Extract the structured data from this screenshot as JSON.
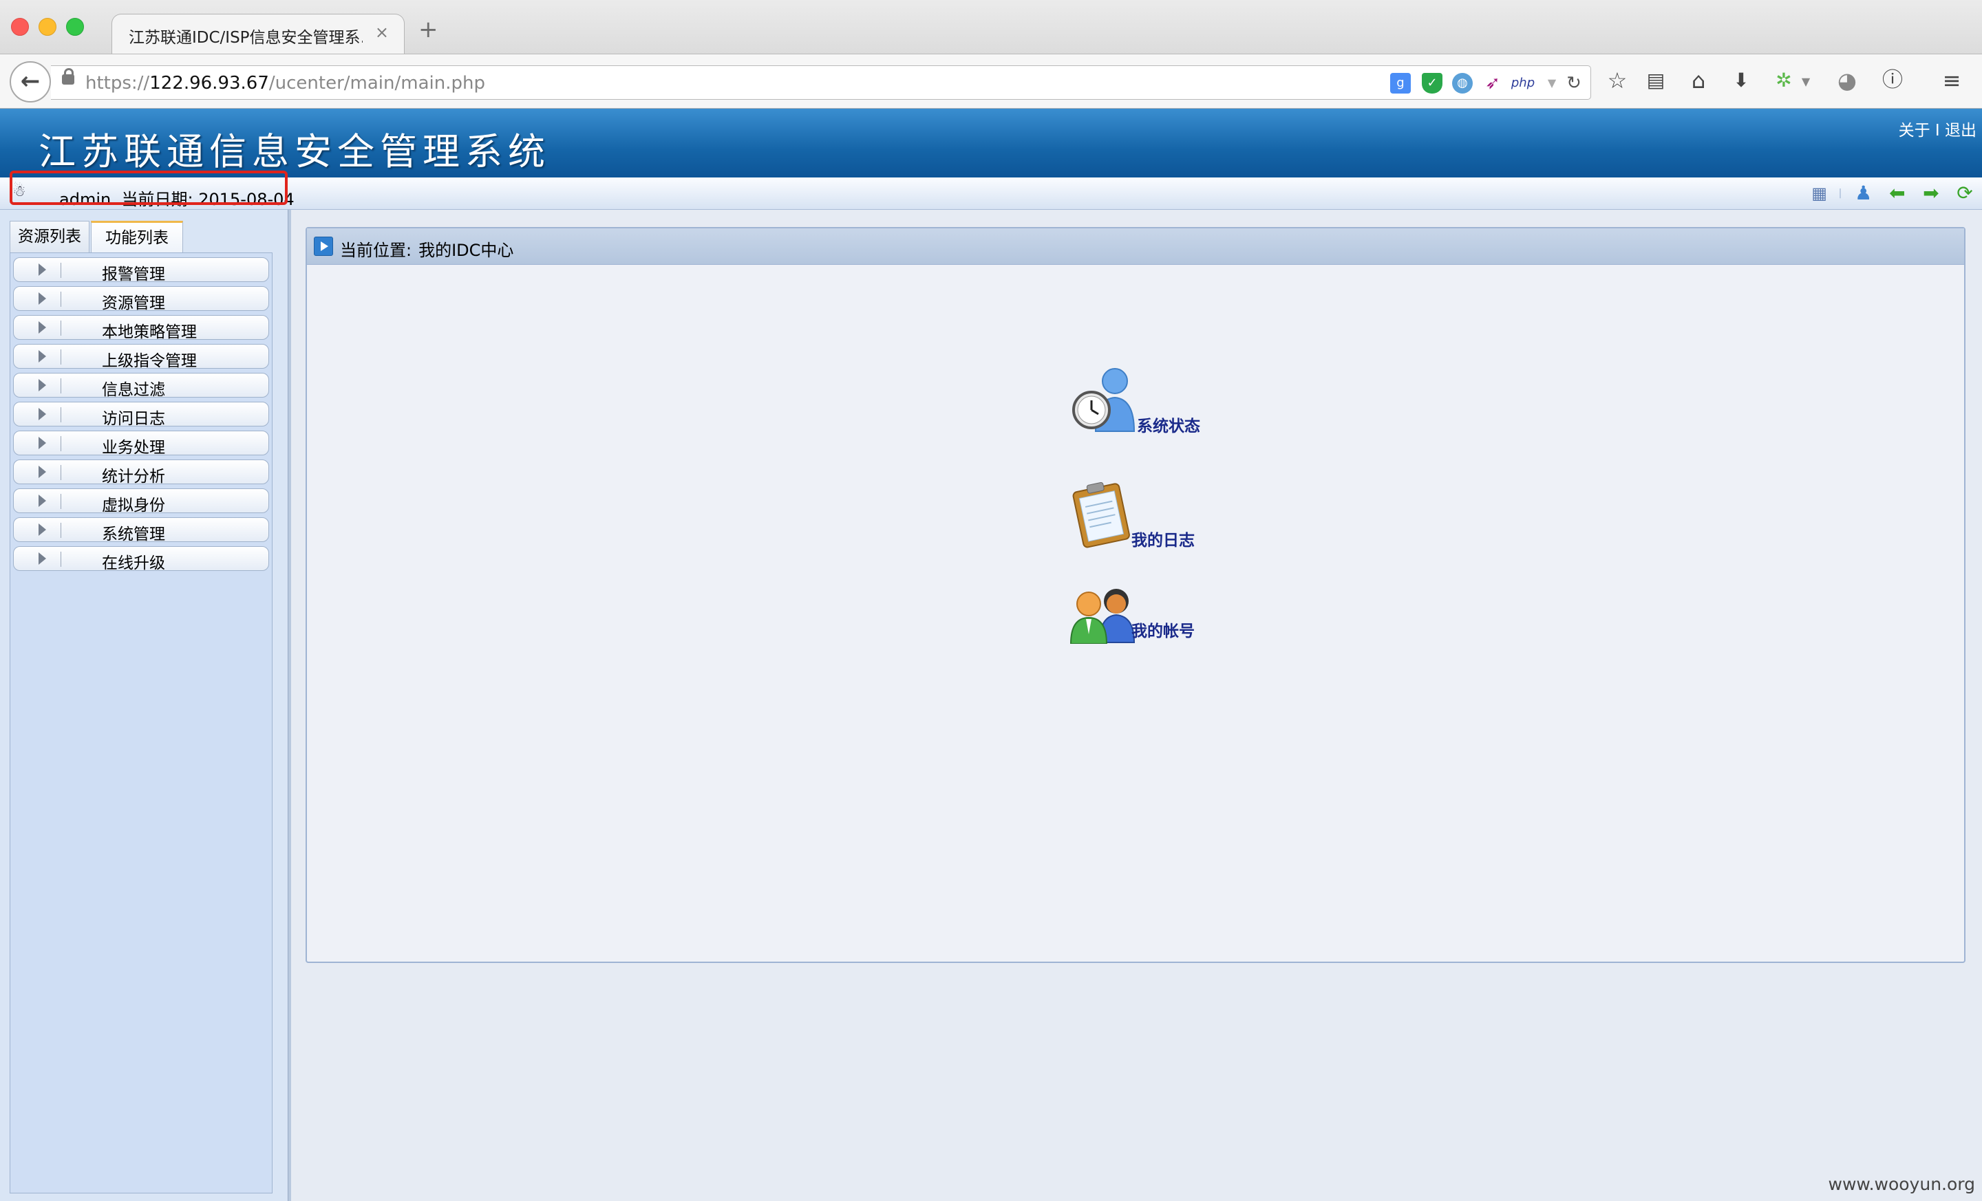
{
  "browser": {
    "tab_title": "江苏联通IDC/ISP信息安全管理系…",
    "tab_close": "×",
    "new_tab": "+",
    "url_prefix": "https://",
    "url_host": "122.96.93.67",
    "url_path": "/ucenter/main/main.php",
    "extensions": [
      "google-icon",
      "shield-icon",
      "globe-icon",
      "feather-icon",
      "php-icon",
      "dropdown-icon"
    ],
    "php_label": "php"
  },
  "app": {
    "title": "江苏联通信息安全管理系统",
    "links": {
      "about": "关于",
      "separator": "I",
      "logout": "退出"
    }
  },
  "infobar": {
    "username": "admin",
    "date_label": "当前日期:",
    "date_value": "2015-08-04"
  },
  "sidebar": {
    "tabs": [
      "资源列表",
      "功能列表"
    ],
    "active_tab": "功能列表",
    "items": [
      {
        "label": "报警管理"
      },
      {
        "label": "资源管理"
      },
      {
        "label": "本地策略管理"
      },
      {
        "label": "上级指令管理"
      },
      {
        "label": "信息过滤"
      },
      {
        "label": "访问日志"
      },
      {
        "label": "业务处理"
      },
      {
        "label": "统计分析"
      },
      {
        "label": "虚拟身份"
      },
      {
        "label": "系统管理"
      },
      {
        "label": "在线升级"
      }
    ]
  },
  "main": {
    "location_label": "当前位置:",
    "location_value": "我的IDC中心",
    "shortcuts": [
      {
        "label": "系统状态",
        "icon": "user-clock-icon"
      },
      {
        "label": "我的日志",
        "icon": "clipboard-icon"
      },
      {
        "label": "我的帐号",
        "icon": "users-icon"
      }
    ]
  },
  "watermark": "www.wooyun.org",
  "colors": {
    "header_blue": "#1565a8",
    "highlight_red": "#e0241c",
    "shortcut_text": "#1a2a8a"
  }
}
